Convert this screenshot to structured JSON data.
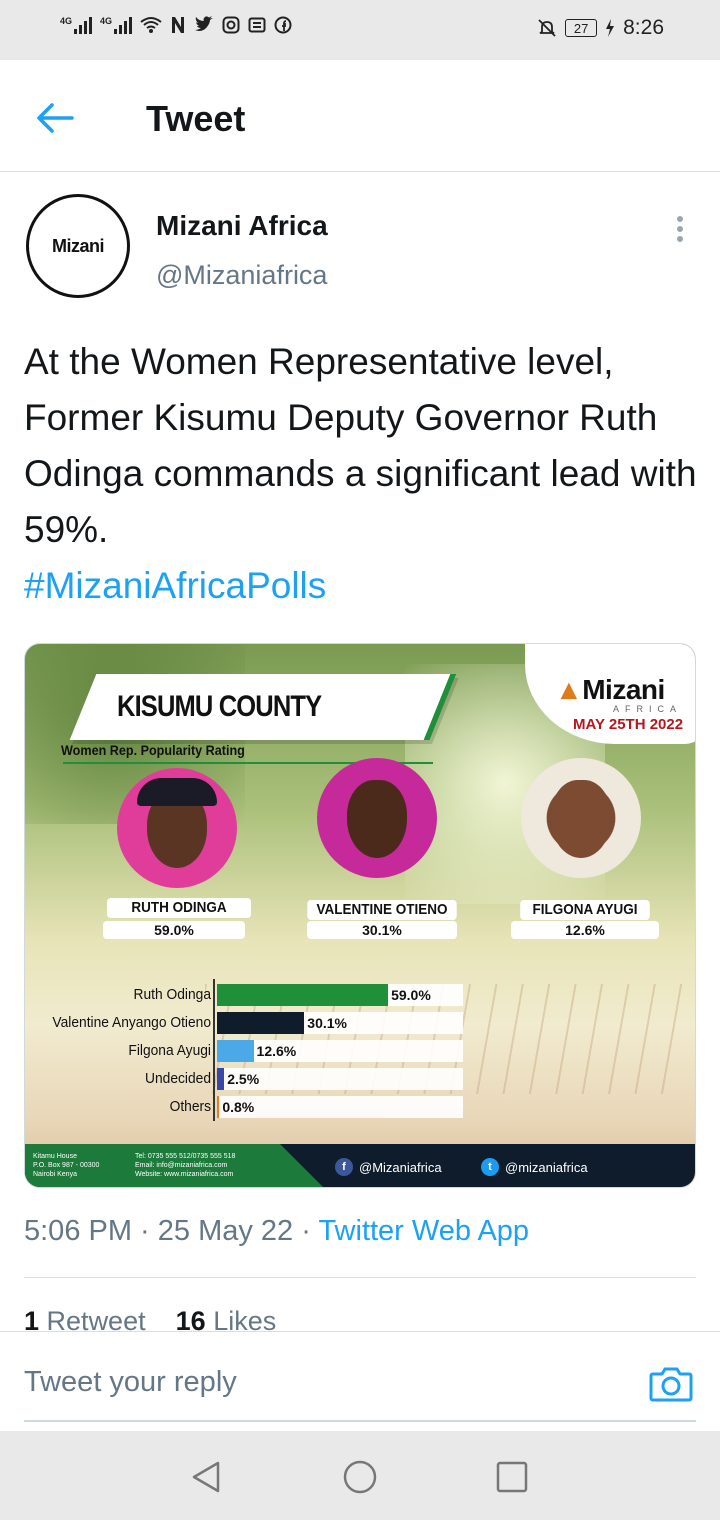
{
  "status_bar": {
    "network_left": "4G",
    "network_right": "4G",
    "battery": "27",
    "time": "8:26",
    "icons": [
      "signal-icon",
      "wifi-icon",
      "netflix-icon",
      "twitter-icon",
      "instagram-icon",
      "news-icon",
      "facebook-icon",
      "mute-icon",
      "charging-icon"
    ]
  },
  "header": {
    "title": "Tweet"
  },
  "tweet": {
    "author_name": "Mizani Africa",
    "author_handle": "@Mizaniafrica",
    "avatar_text": "Mizani",
    "text": "At the Women Representative level, Former Kisumu Deputy Governor Ruth Odinga commands a significant lead with 59%.",
    "hashtag": "#MizaniAfricaPolls",
    "timestamp": "5:06 PM · 25 May 22 · ",
    "source": "Twitter Web App",
    "retweets_count": "1",
    "retweets_label": "Retweet",
    "likes_count": "16",
    "likes_label": "Likes"
  },
  "card": {
    "title": "KISUMU COUNTY",
    "subtitle": "Women Rep. Popularity Rating",
    "logo": "Mizani",
    "logo_sub": "AFRICA",
    "date": "MAY 25TH 2022",
    "candidates": [
      {
        "name": "RUTH ODINGA",
        "pct": "59.0%"
      },
      {
        "name": "VALENTINE OTIENO",
        "pct": "30.1%"
      },
      {
        "name": "FILGONA AYUGI",
        "pct": "12.6%"
      }
    ],
    "footer": {
      "address": [
        "Kitamu House",
        "P.O. Box 987 - 00300",
        "Nairobi Kenya"
      ],
      "contact": [
        "Tel: 0735 555 512/0735 555 518",
        "Email: info@mizaniafrica.com",
        "Website: www.mizaniafrica.com"
      ],
      "facebook": "@Mizaniafrica",
      "twitter": "@mizaniafrica"
    }
  },
  "chart_data": {
    "type": "bar",
    "orientation": "horizontal",
    "categories": [
      "Ruth Odinga",
      "Valentine Anyango Otieno",
      "Filgona Ayugi",
      "Undecided",
      "Others"
    ],
    "values": [
      59.0,
      30.1,
      12.6,
      2.5,
      0.8
    ],
    "value_labels": [
      "59.0%",
      "30.1%",
      "12.6%",
      "2.5%",
      "0.8%"
    ],
    "colors": [
      "#1f8f3a",
      "#0f1c2c",
      "#4aa9e6",
      "#3848a8",
      "#f07b1e"
    ],
    "xlim": [
      0,
      100
    ]
  },
  "reply": {
    "placeholder": "Tweet your reply"
  },
  "colors": {
    "accent": "#1da1f2",
    "muted": "#657786"
  }
}
